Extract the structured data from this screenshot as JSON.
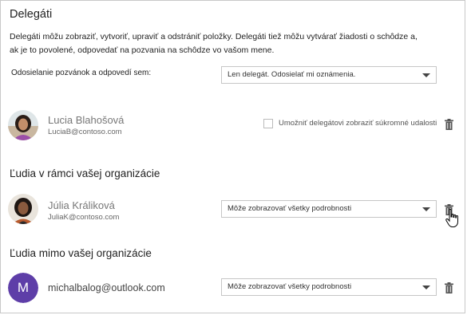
{
  "header": {
    "title": "Delegáti",
    "description": "Delegáti môžu zobraziť, vytvoriť, upraviť a odstrániť položky. Delegáti tiež môžu vytvárať žiadosti o schôdze a, ak je to povolené, odpovedať na pozvania na schôdze vo vašom mene."
  },
  "invitations": {
    "label": "Odosielanie pozvánok a odpovedí sem:",
    "selected": "Len delegát. Odosielať mi oznámenia."
  },
  "delegate": {
    "name": "Lucia Blahošová",
    "email": "LuciaB@contoso.com",
    "private_label": "Umožniť delegátovi zobraziť súkromné udalosti"
  },
  "internal": {
    "section_title": "Ľudia v rámci vašej organizácie",
    "person": {
      "name": "Júlia Králiková",
      "email": "JuliaK@contoso.com",
      "permission": "Môže zobrazovať všetky podrobnosti"
    }
  },
  "external": {
    "section_title": "Ľudia mimo vašej organizácie",
    "person": {
      "initial": "M",
      "email": "michalbalog@outlook.com",
      "permission": "Môže zobrazovať všetky podrobnosti"
    }
  },
  "icons": [
    "trash-icon",
    "chevron-down-icon",
    "hand-cursor-icon"
  ],
  "colors": {
    "avatar_purple": "#5e3ea8",
    "border": "#c6c6c6"
  }
}
